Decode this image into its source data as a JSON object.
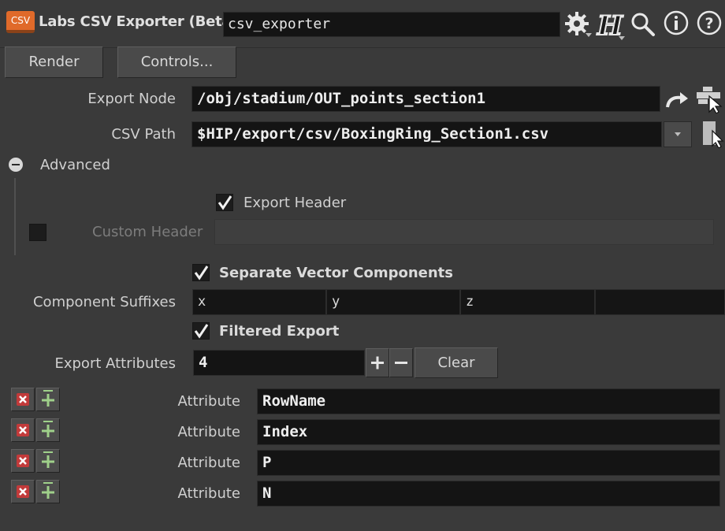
{
  "header": {
    "badge": "CSV",
    "node_type": "Labs CSV Exporter (Beta)",
    "node_name": "csv_exporter",
    "icons": [
      "gear-icon",
      "houdini-help-icon",
      "search-icon",
      "info-icon",
      "help-icon"
    ]
  },
  "buttons": {
    "render": "Render",
    "controls": "Controls..."
  },
  "params": {
    "export_node": {
      "label": "Export Node",
      "value": "/obj/stadium/OUT_points_section1"
    },
    "csv_path": {
      "label": "CSV Path",
      "value": "$HIP/export/csv/BoxingRing_Section1.csv"
    },
    "advanced": {
      "label": "Advanced",
      "expanded": true
    },
    "export_header": {
      "label": "Export Header",
      "checked": true
    },
    "custom_header": {
      "label": "Custom Header",
      "checked": false,
      "value": ""
    },
    "separate_vector": {
      "label": "Separate Vector Components",
      "checked": true
    },
    "component_suffixes": {
      "label": "Component Suffixes",
      "values": [
        "x",
        "y",
        "z",
        ""
      ]
    },
    "filtered_export": {
      "label": "Filtered Export",
      "checked": true
    },
    "export_attributes": {
      "label": "Export Attributes",
      "count": "4",
      "clear_label": "Clear"
    }
  },
  "attributes": [
    {
      "label": "Attribute",
      "value": "RowName"
    },
    {
      "label": "Attribute",
      "value": "Index"
    },
    {
      "label": "Attribute",
      "value": "P"
    },
    {
      "label": "Attribute",
      "value": "N"
    }
  ],
  "colors": {
    "background": "#3a3a3a",
    "field": "#141414",
    "badge": "#e06a2a"
  }
}
